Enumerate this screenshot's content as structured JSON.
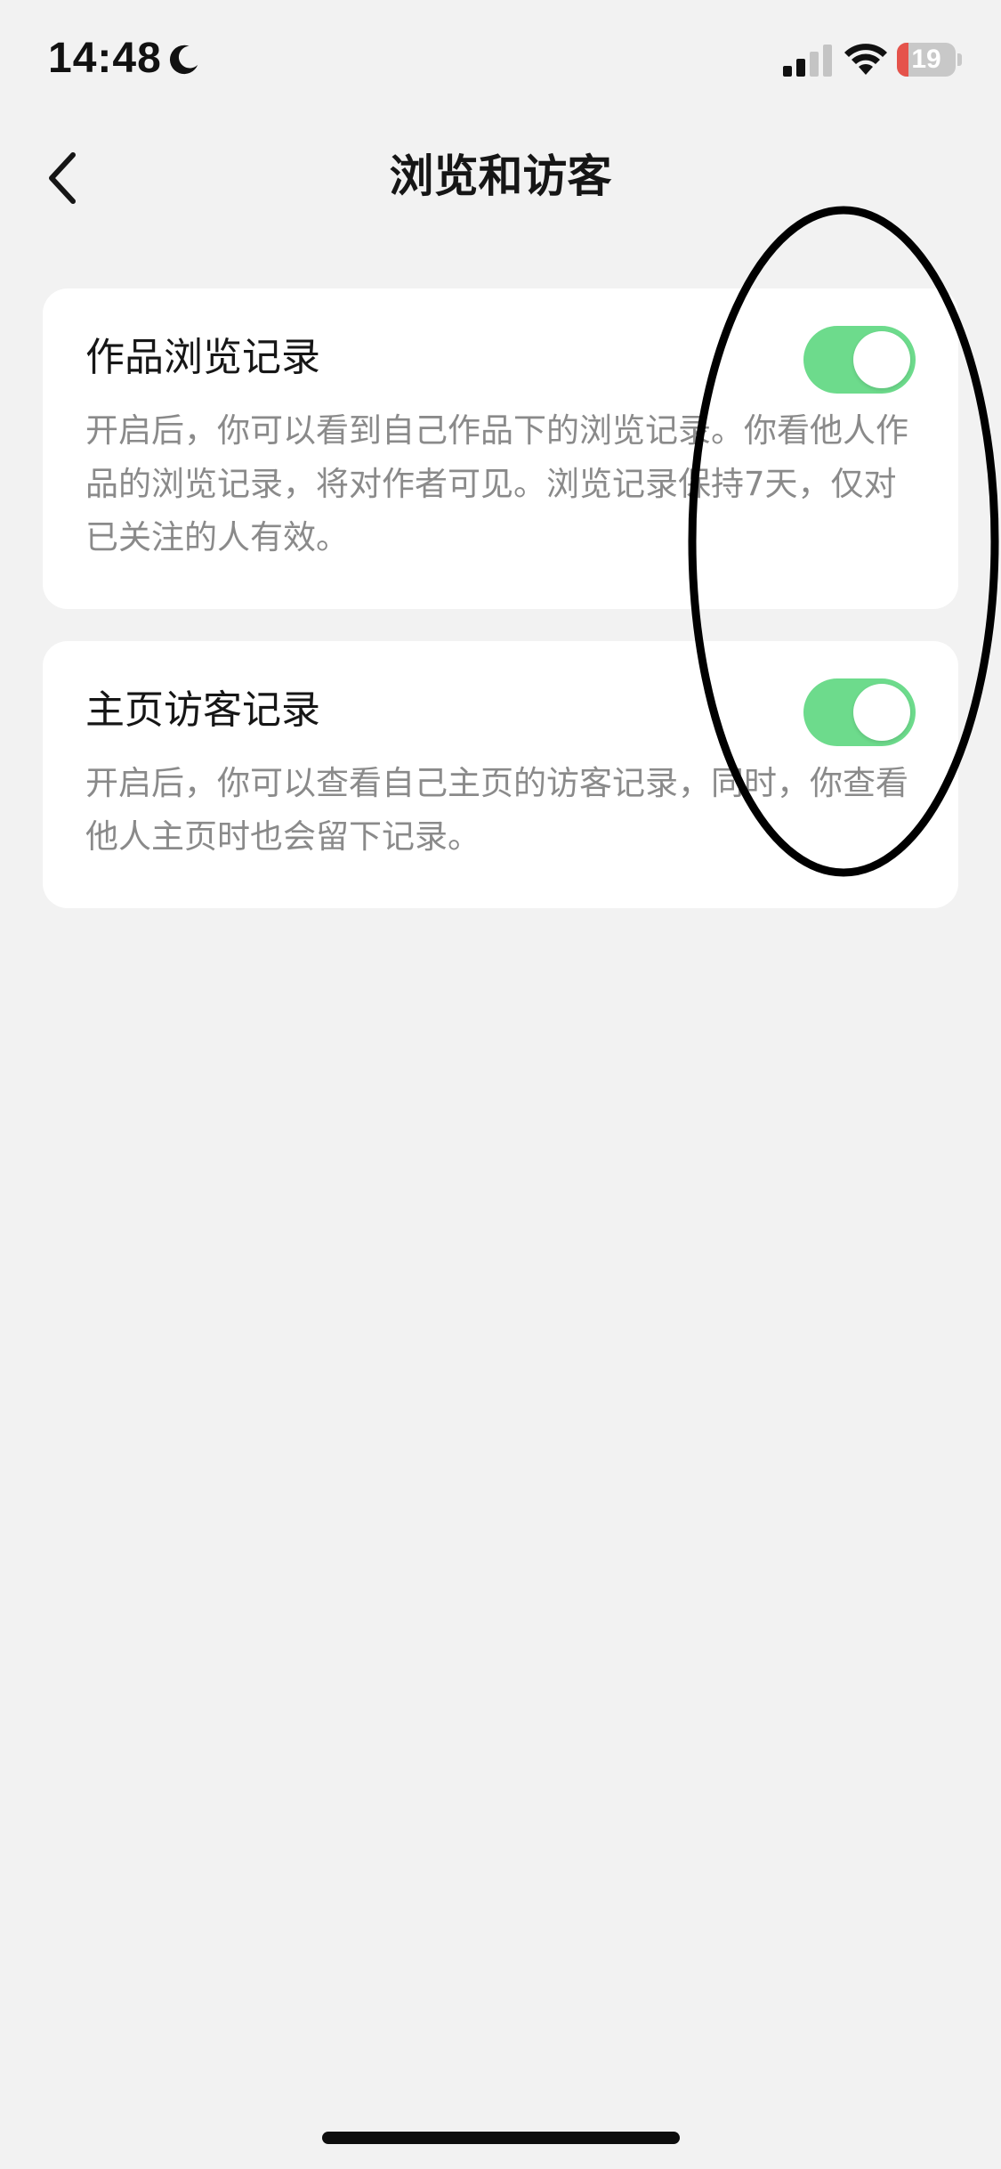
{
  "status_bar": {
    "time": "14:48",
    "focus_icon": "moon-icon",
    "signal_icon": "cellular-signal-icon",
    "wifi_icon": "wifi-icon",
    "battery_level": "19",
    "battery_fraction": 0.19,
    "battery_color": "#e5534b"
  },
  "nav": {
    "back_icon": "chevron-left-icon",
    "title": "浏览和访客"
  },
  "settings": [
    {
      "title": "作品浏览记录",
      "description": "开启后，你可以看到自己作品下的浏览记录。你看他人作品的浏览记录，将对作者可见。浏览记录保持7天，仅对已关注的人有效。",
      "enabled": true
    },
    {
      "title": "主页访客记录",
      "description": "开启后，你可以查看自己主页的访客记录，同时，你查看他人主页时也会留下记录。",
      "enabled": true
    }
  ],
  "colors": {
    "background": "#f2f2f2",
    "toggle_on": "#6ddb8c",
    "description_text": "#8a8a8a"
  }
}
